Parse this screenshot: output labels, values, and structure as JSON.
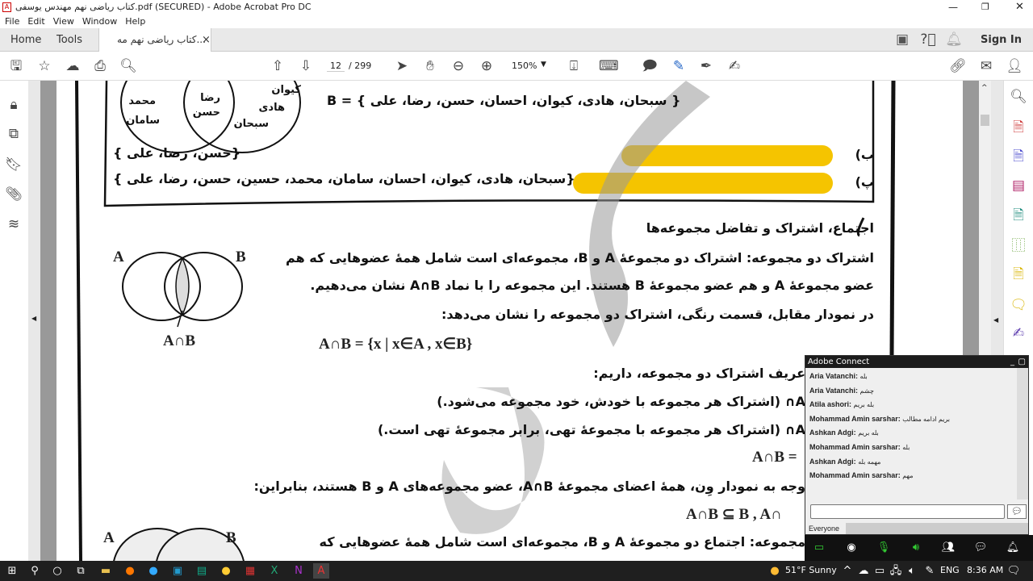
{
  "window": {
    "title": "کتاب ریاضی نهم مهندس یوسفی.pdf (SECURED) - Adobe Acrobat Pro DC"
  },
  "menu": [
    "File",
    "Edit",
    "View",
    "Window",
    "Help"
  ],
  "tabs": {
    "home": "Home",
    "tools": "Tools",
    "doc": "کتاب ریاضی نهم مه...",
    "close": "×",
    "sign_in": "Sign In"
  },
  "toolbar": {
    "page_current": "12",
    "page_total": "/ 299",
    "zoom": "150%"
  },
  "doc": {
    "venn_top_labels": [
      "محمد",
      "سامان",
      "رضا",
      "حسن",
      "کیوان",
      "هادی",
      "سبحان"
    ],
    "set_b": "B = { سبحان، هادی، کیوان، احسان، حسن، رضا، علی }",
    "label_b": "ب)",
    "ans_b": "{حسن، رضا، علی }",
    "label_p": "پ)",
    "ans_p": "{سبحان، هادی، کیوان، احسان، سامان، محمد، حسین، حسن، رضا، علی }",
    "heading": "اجتماع، اشتراک و تفاضل مجموعه‌ها",
    "para1": "اشتراک دو مجموعه: اشتراک دو مجموعهٔ A و B، مجموعه‌ای است شامل همهٔ عضوهایی که هم",
    "para2": "عضو مجموعهٔ A و هم عضو مجموعهٔ B هستند. این مجموعه را با نماد A∩B نشان می‌دهیم.",
    "para3": "در نمودار مقابل، قسمت رنگی، اشتراک دو مجموعه را نشان می‌دهد:",
    "formula": "A∩B = {x | x∈A , x∈B}",
    "venn_a": "A",
    "venn_b": "B",
    "venn_label": "A∩B",
    "line4": "عریف اشتراک دو مجموعه، داریم:",
    "line5": "A∩ (اشتراک هر مجموعه با خودش، خود مجموعه می‌شود.)",
    "line6": "A∩ (اشتراک هر مجموعه با مجموعهٔ تهی، برابر مجموعهٔ تهی است.)",
    "line7": "A∩B =",
    "line8": "وجه به نمودار وِن، همهٔ اعضای مجموعهٔ A∩B، عضو مجموعه‌های A و B هستند، بنابراین:",
    "line9": "A∩B ⊆ B , A∩",
    "line10": "مجموعه: اجتماع دو مجموعهٔ A و B، مجموعه‌ای است شامل همهٔ عضوهایی که"
  },
  "chat": {
    "title": "Adobe Connect",
    "messages": [
      {
        "user": "Aria Vatanchi:",
        "text": "بله"
      },
      {
        "user": "Aria Vatanchi:",
        "text": "چشم"
      },
      {
        "user": "Atila ashori:",
        "text": "بله بریم"
      },
      {
        "user": "Mohammad Amin sarshar:",
        "text": "بریم ادامه مطالب"
      },
      {
        "user": "Ashkan Adgi:",
        "text": "بله بریم"
      },
      {
        "user": "Mohammad Amin sarshar:",
        "text": "بله"
      },
      {
        "user": "Ashkan Adgi:",
        "text": "مهمه بله"
      },
      {
        "user": "Mohammad Amin sarshar:",
        "text": "مهم"
      }
    ],
    "audience": "Everyone"
  },
  "taskbar": {
    "weather": "51°F  Sunny",
    "lang": "ENG",
    "time": "8:36 AM"
  },
  "colors": {
    "highlight": "#f5c400",
    "chat_header": "#1c1c1c"
  }
}
